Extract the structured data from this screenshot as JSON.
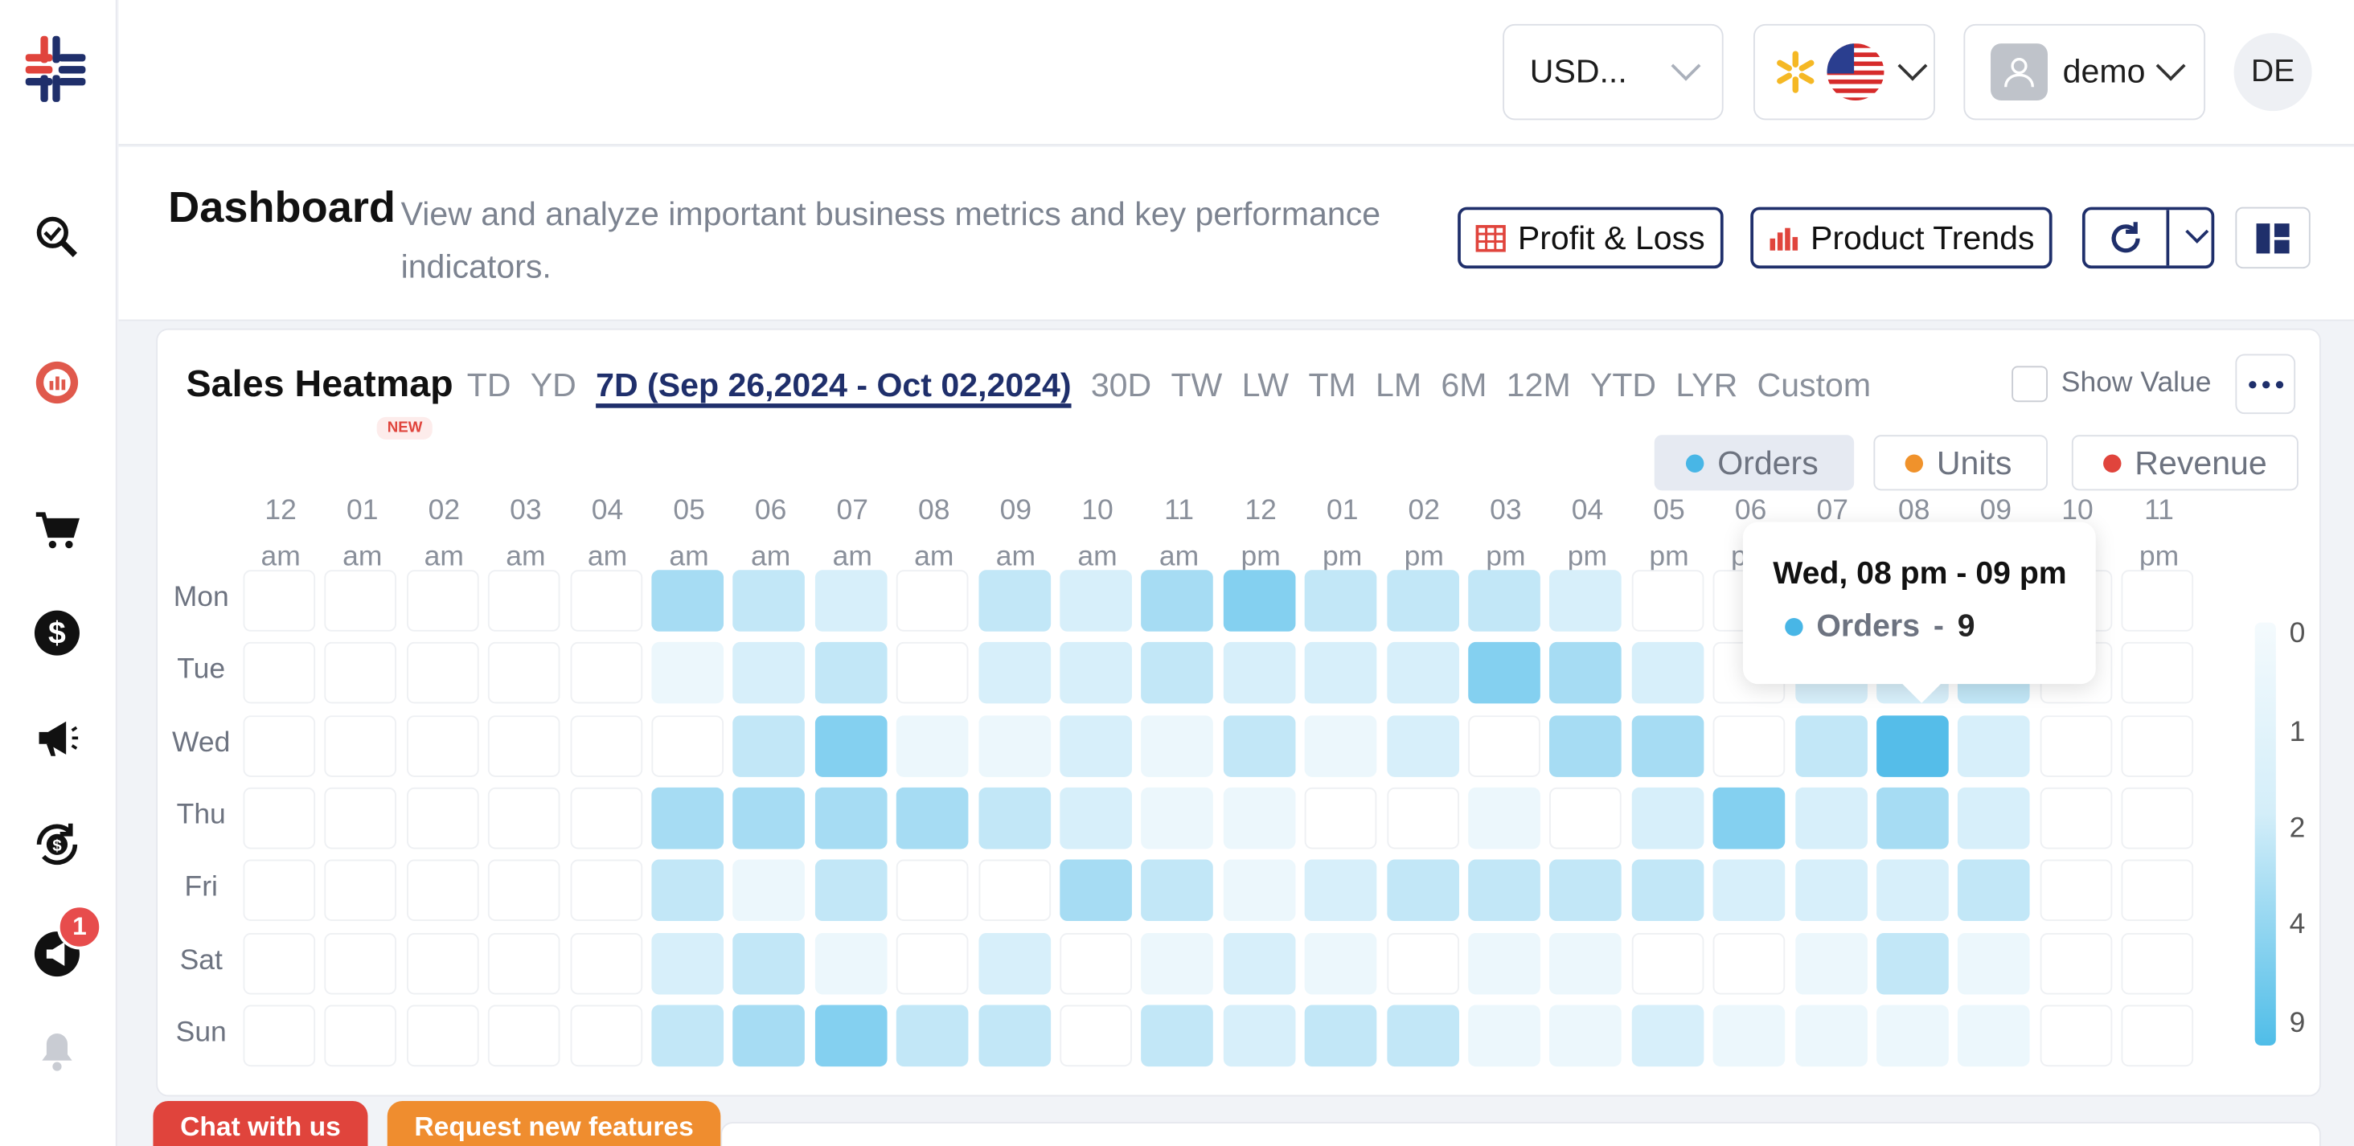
{
  "header": {
    "currency": "USD...",
    "user": "demo",
    "initials": "DE"
  },
  "page": {
    "title": "Dashboard",
    "subtitle": "View and analyze important business metrics and key performance indicators.",
    "buttons": {
      "pnl": "Profit & Loss",
      "trends": "Product Trends"
    }
  },
  "sidebar": {
    "notification_count": "1"
  },
  "heatmap": {
    "title": "Sales Heatmap",
    "new_badge": "NEW",
    "ranges": [
      "TD",
      "YD",
      "7D (Sep 26,2024 - Oct 02,2024)",
      "30D",
      "TW",
      "LW",
      "TM",
      "LM",
      "6M",
      "12M",
      "YTD",
      "LYR",
      "Custom"
    ],
    "active_range": 2,
    "show_value_label": "Show Value",
    "metrics": [
      {
        "label": "Orders",
        "color": "#48b6e6",
        "active": true
      },
      {
        "label": "Units",
        "color": "#f0922b",
        "active": false
      },
      {
        "label": "Revenue",
        "color": "#e0443c",
        "active": false
      }
    ],
    "hours": [
      "12",
      "01",
      "02",
      "03",
      "04",
      "05",
      "06",
      "07",
      "08",
      "09",
      "10",
      "11",
      "12",
      "01",
      "02",
      "03",
      "04",
      "05",
      "06",
      "07",
      "08",
      "09",
      "10",
      "11"
    ],
    "meridiem": [
      "am",
      "am",
      "am",
      "am",
      "am",
      "am",
      "am",
      "am",
      "am",
      "am",
      "am",
      "am",
      "pm",
      "pm",
      "pm",
      "pm",
      "pm",
      "pm",
      "pm",
      "pm",
      "pm",
      "pm",
      "pm",
      "pm"
    ],
    "days": [
      "Mon",
      "Tue",
      "Wed",
      "Thu",
      "Fri",
      "Sat",
      "Sun"
    ],
    "intensity": [
      [
        0,
        0,
        0,
        0,
        0,
        4,
        3,
        2,
        0,
        3,
        2,
        4,
        5,
        3,
        3,
        3,
        2,
        0,
        0,
        0,
        0,
        0,
        0,
        0
      ],
      [
        0,
        0,
        0,
        0,
        0,
        1,
        2,
        3,
        0,
        2,
        2,
        3,
        2,
        2,
        2,
        5,
        4,
        2,
        0,
        2,
        2,
        3,
        0,
        0
      ],
      [
        0,
        0,
        0,
        0,
        0,
        0,
        3,
        5,
        1,
        1,
        2,
        1,
        3,
        1,
        2,
        0,
        4,
        4,
        0,
        3,
        6,
        2,
        0,
        0
      ],
      [
        0,
        0,
        0,
        0,
        0,
        4,
        4,
        4,
        4,
        3,
        2,
        1,
        1,
        0,
        0,
        1,
        0,
        2,
        5,
        2,
        4,
        2,
        0,
        0
      ],
      [
        0,
        0,
        0,
        0,
        0,
        3,
        1,
        3,
        0,
        0,
        4,
        3,
        1,
        2,
        3,
        3,
        3,
        3,
        2,
        2,
        2,
        3,
        0,
        0
      ],
      [
        0,
        0,
        0,
        0,
        0,
        2,
        3,
        1,
        0,
        2,
        0,
        1,
        2,
        1,
        0,
        1,
        1,
        0,
        0,
        1,
        3,
        1,
        0,
        0
      ],
      [
        0,
        0,
        0,
        0,
        0,
        3,
        4,
        5,
        3,
        3,
        0,
        3,
        2,
        3,
        3,
        1,
        1,
        2,
        1,
        1,
        1,
        1,
        0,
        0
      ]
    ],
    "legend": [
      "0",
      "1",
      "2",
      "4",
      "9"
    ],
    "tooltip": {
      "title": "Wed, 08 pm - 09 pm",
      "metric": "Orders",
      "value": "9"
    }
  },
  "footer": {
    "chat": "Chat with us",
    "request": "Request new features"
  }
}
